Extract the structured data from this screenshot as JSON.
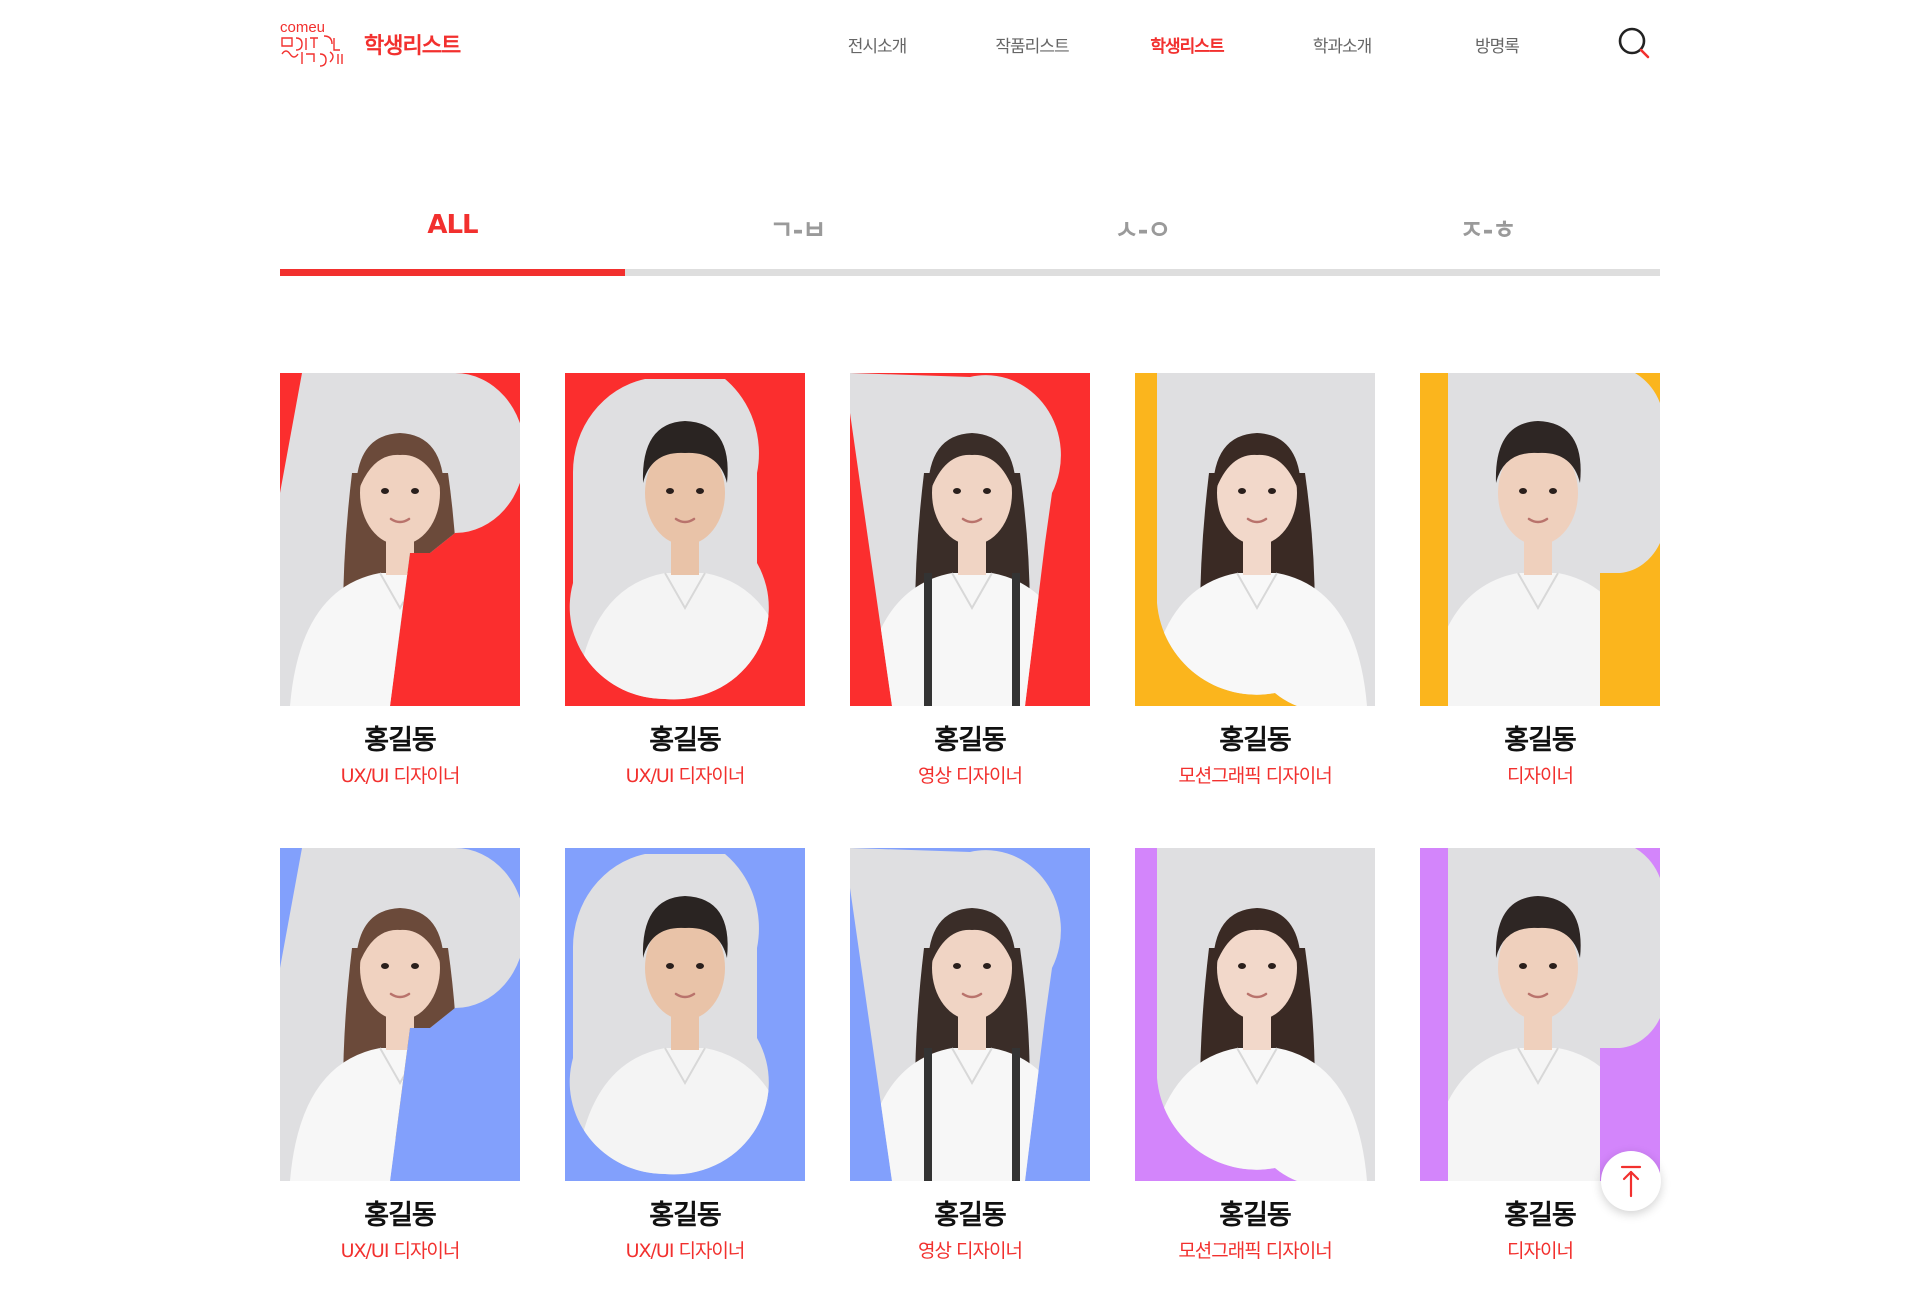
{
  "header": {
    "logo_text": "comeu",
    "title": "학생리스트",
    "nav": [
      {
        "label": "전시소개",
        "active": false
      },
      {
        "label": "작품리스트",
        "active": false
      },
      {
        "label": "학생리스트",
        "active": true
      },
      {
        "label": "학과소개",
        "active": false
      },
      {
        "label": "방명록",
        "active": false
      }
    ],
    "search_icon": "search-icon"
  },
  "tabs": [
    {
      "label": "ALL",
      "active": true
    },
    {
      "label": "ㄱ-ㅂ",
      "active": false
    },
    {
      "label": "ㅅ-ㅇ",
      "active": false
    },
    {
      "label": "ㅈ-ㅎ",
      "active": false
    }
  ],
  "colors": {
    "accent": "#f2302e",
    "red": "#fb2e2e",
    "yellow": "#fbb51d",
    "blue": "#82a0fc",
    "purple": "#d385fb",
    "photo_bg": "#dfdfe1"
  },
  "students": [
    {
      "name": "홍길동",
      "role": "UX/UI 디자이너",
      "color": "#fb2e2e",
      "portrait": "woman-wavy-hair"
    },
    {
      "name": "홍길동",
      "role": "UX/UI 디자이너",
      "color": "#fb2e2e",
      "portrait": "man-short-hair"
    },
    {
      "name": "홍길동",
      "role": "영상 디자이너",
      "color": "#fb2e2e",
      "portrait": "woman-ponytail-suspenders"
    },
    {
      "name": "홍길동",
      "role": "모션그래픽 디자이너",
      "color": "#fbb51d",
      "portrait": "woman-long-hair"
    },
    {
      "name": "홍길동",
      "role": "디자이너",
      "color": "#fbb51d",
      "portrait": "man-white-shirt"
    },
    {
      "name": "홍길동",
      "role": "UX/UI 디자이너",
      "color": "#82a0fc",
      "portrait": "woman-wavy-hair"
    },
    {
      "name": "홍길동",
      "role": "UX/UI 디자이너",
      "color": "#82a0fc",
      "portrait": "man-short-hair"
    },
    {
      "name": "홍길동",
      "role": "영상 디자이너",
      "color": "#82a0fc",
      "portrait": "woman-ponytail-suspenders"
    },
    {
      "name": "홍길동",
      "role": "모션그래픽 디자이너",
      "color": "#d385fb",
      "portrait": "woman-long-hair"
    },
    {
      "name": "홍길동",
      "role": "디자이너",
      "color": "#d385fb",
      "portrait": "man-white-shirt"
    }
  ],
  "top_button_icon": "arrow-up-icon"
}
